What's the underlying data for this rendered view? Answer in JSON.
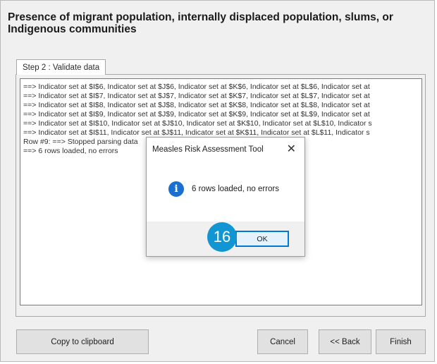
{
  "window": {
    "title": "Presence of migrant population, internally displaced population, slums, or Indigenous communities"
  },
  "tabs": [
    {
      "label": "Step 2 : Validate data"
    }
  ],
  "log": {
    "lines": [
      "==> Indicator set at $I$6, Indicator set at $J$6, Indicator set at $K$6, Indicator set at $L$6, Indicator set at",
      "==> Indicator set at $I$7, Indicator set at $J$7, Indicator set at $K$7, Indicator set at $L$7, Indicator set at",
      "==> Indicator set at $I$8, Indicator set at $J$8, Indicator set at $K$8, Indicator set at $L$8, Indicator set at",
      "==> Indicator set at $I$9, Indicator set at $J$9, Indicator set at $K$9, Indicator set at $L$9, Indicator set at",
      "==> Indicator set at $I$10, Indicator set at $J$10, Indicator set at $K$10, Indicator set at $L$10, Indicator s",
      "==> Indicator set at $I$11, Indicator set at $J$11, Indicator set at $K$11, Indicator set at $L$11, Indicator s",
      "Row #9: ==> Stopped parsing data",
      "==> 6 rows loaded, no errors"
    ]
  },
  "buttons": {
    "copy": "Copy to clipboard",
    "cancel": "Cancel",
    "back": "<< Back",
    "finish": "Finish"
  },
  "dialog": {
    "title": "Measles Risk Assessment Tool",
    "close": "✕",
    "message": "6 rows loaded, no errors",
    "ok": "OK",
    "icon": "info-icon"
  },
  "callout": {
    "step_number": "16"
  },
  "colors": {
    "accent": "#0078d7",
    "info_icon": "#1b6fd1",
    "badge": "#1296d3"
  }
}
